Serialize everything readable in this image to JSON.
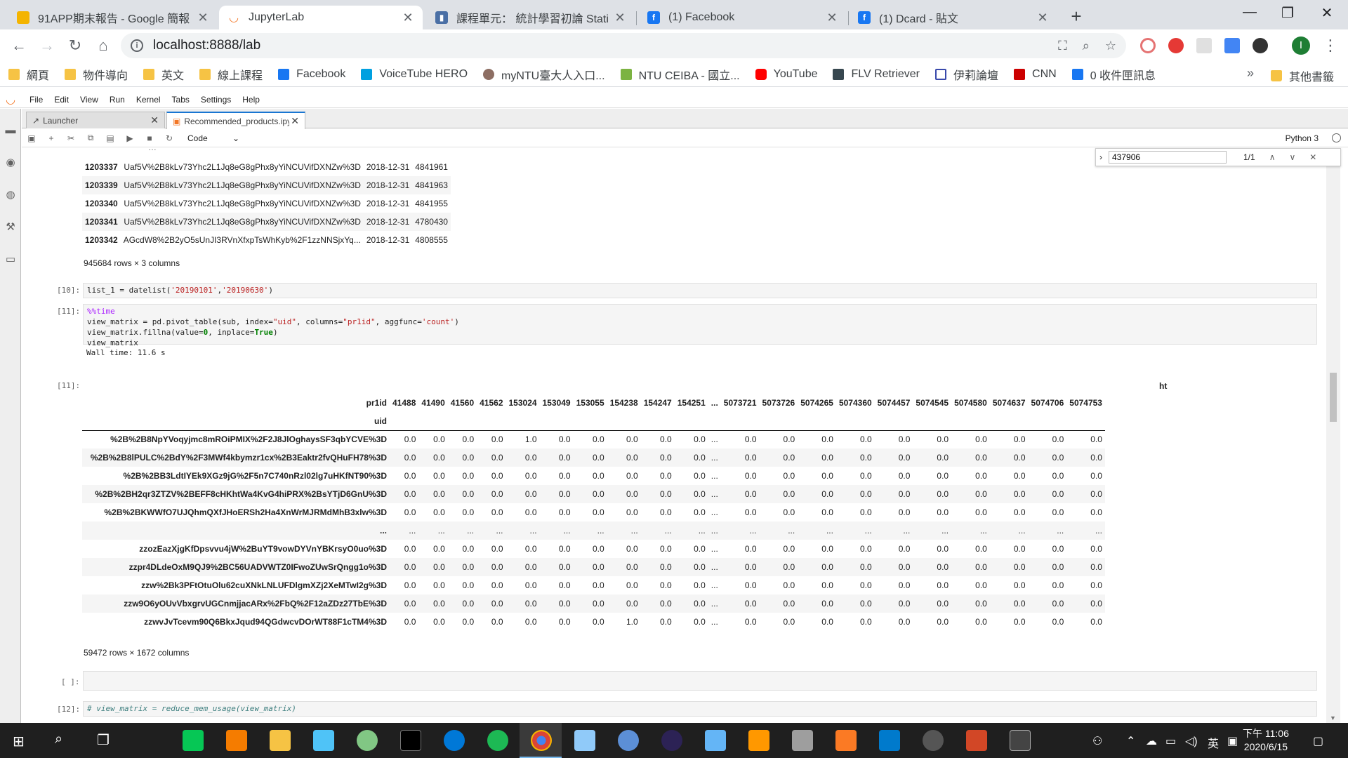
{
  "browser": {
    "tabs": [
      {
        "title": "91APP期末報告 - Google 簡報",
        "favicon": "slides"
      },
      {
        "title": "JupyterLab",
        "favicon": "jupyter",
        "active": true
      },
      {
        "title": "課程單元： 統計學習初論 Statisti",
        "favicon": "chart"
      },
      {
        "title": "(1) Facebook",
        "favicon": "facebook"
      },
      {
        "title": "(1) Dcard - 貼文",
        "favicon": "facebook"
      }
    ],
    "url": "localhost:8888/lab",
    "profile_initial": "I",
    "bookmarks": [
      {
        "label": "網頁",
        "icon": "folder"
      },
      {
        "label": "物件導向",
        "icon": "folder"
      },
      {
        "label": "英文",
        "icon": "folder"
      },
      {
        "label": "線上課程",
        "icon": "folder"
      },
      {
        "label": "Facebook",
        "icon": "facebook"
      },
      {
        "label": "VoiceTube HERO",
        "icon": "voicetube"
      },
      {
        "label": "myNTU臺大人入口...",
        "icon": "ntu"
      },
      {
        "label": "NTU CEIBA - 國立...",
        "icon": "ceiba"
      },
      {
        "label": "YouTube",
        "icon": "youtube"
      },
      {
        "label": "FLV Retriever",
        "icon": "flv"
      },
      {
        "label": "伊莉論壇",
        "icon": "eyny"
      },
      {
        "label": "CNN",
        "icon": "cnn"
      },
      {
        "label": "0 收件匣訊息",
        "icon": "facebook"
      }
    ],
    "bookmarks_more": "»",
    "other_bookmarks": "其他書籤"
  },
  "jupyter": {
    "menu": [
      "File",
      "Edit",
      "View",
      "Run",
      "Kernel",
      "Tabs",
      "Settings",
      "Help"
    ],
    "doc_tabs": [
      {
        "label": "Launcher",
        "active": false
      },
      {
        "label": "Recommended_products.ipy",
        "active": true
      }
    ],
    "cell_type": "Code",
    "kernel": "Python 3",
    "find": {
      "query": "437906",
      "count": "1/1"
    }
  },
  "output1": {
    "rows": [
      {
        "idx": "1203337",
        "uid": "Uaf5V%2B8kLv73Yhc2L1Jq8eG8gPhx8yYiNCUVifDXNZw%3D",
        "date": "2018-12-31",
        "id": "4841961"
      },
      {
        "idx": "1203339",
        "uid": "Uaf5V%2B8kLv73Yhc2L1Jq8eG8gPhx8yYiNCUVifDXNZw%3D",
        "date": "2018-12-31",
        "id": "4841963"
      },
      {
        "idx": "1203340",
        "uid": "Uaf5V%2B8kLv73Yhc2L1Jq8eG8gPhx8yYiNCUVifDXNZw%3D",
        "date": "2018-12-31",
        "id": "4841955"
      },
      {
        "idx": "1203341",
        "uid": "Uaf5V%2B8kLv73Yhc2L1Jq8eG8gPhx8yYiNCUVifDXNZw%3D",
        "date": "2018-12-31",
        "id": "4780430"
      },
      {
        "idx": "1203342",
        "uid": "AGcdW8%2B2yO5sUnJI3RVnXfxpTsWhKyb%2F1zzNNSjxYq...",
        "date": "2018-12-31",
        "id": "4808555"
      }
    ],
    "shape": "945684 rows × 3 columns"
  },
  "cell10": {
    "prompt": "[10]:"
  },
  "cell11": {
    "prompt": "[11]:",
    "wall_time": "Wall time: 11.6 s",
    "out_prompt": "[11]:"
  },
  "pivot": {
    "top_label": "ht",
    "columns_name": "pr1id",
    "index_name": "uid",
    "columns": [
      "41488",
      "41490",
      "41560",
      "41562",
      "153024",
      "153049",
      "153055",
      "154238",
      "154247",
      "154251",
      "...",
      "5073721",
      "5073726",
      "5074265",
      "5074360",
      "5074457",
      "5074545",
      "5074580",
      "5074637",
      "5074706",
      "5074753"
    ],
    "rows": [
      {
        "uid": "%2B%2B8NpYVoqyjmc8mROiPMIX%2F2J8JlOghaysSF3qbYCVE%3D",
        "values": [
          "0.0",
          "0.0",
          "0.0",
          "0.0",
          "1.0",
          "0.0",
          "0.0",
          "0.0",
          "0.0",
          "0.0",
          "...",
          "0.0",
          "0.0",
          "0.0",
          "0.0",
          "0.0",
          "0.0",
          "0.0",
          "0.0",
          "0.0",
          "0.0"
        ]
      },
      {
        "uid": "%2B%2B8lPULC%2BdY%2F3MWf4kbymzr1cx%2B3Eaktr2fvQHuFH78%3D",
        "values": [
          "0.0",
          "0.0",
          "0.0",
          "0.0",
          "0.0",
          "0.0",
          "0.0",
          "0.0",
          "0.0",
          "0.0",
          "...",
          "0.0",
          "0.0",
          "0.0",
          "0.0",
          "0.0",
          "0.0",
          "0.0",
          "0.0",
          "0.0",
          "0.0"
        ]
      },
      {
        "uid": "%2B%2BB3LdtIYEk9XGz9jG%2F5n7C740nRzl02lg7uHKfNT90%3D",
        "values": [
          "0.0",
          "0.0",
          "0.0",
          "0.0",
          "0.0",
          "0.0",
          "0.0",
          "0.0",
          "0.0",
          "0.0",
          "...",
          "0.0",
          "0.0",
          "0.0",
          "0.0",
          "0.0",
          "0.0",
          "0.0",
          "0.0",
          "0.0",
          "0.0"
        ]
      },
      {
        "uid": "%2B%2BH2qr3ZTZV%2BEFF8cHKhtWa4KvG4hiPRX%2BsYTjD6GnU%3D",
        "values": [
          "0.0",
          "0.0",
          "0.0",
          "0.0",
          "0.0",
          "0.0",
          "0.0",
          "0.0",
          "0.0",
          "0.0",
          "...",
          "0.0",
          "0.0",
          "0.0",
          "0.0",
          "0.0",
          "0.0",
          "0.0",
          "0.0",
          "0.0",
          "0.0"
        ]
      },
      {
        "uid": "%2B%2BKWWfO7UJQhmQXfJHoERSh2Ha4XnWrMJRMdMhB3xlw%3D",
        "values": [
          "0.0",
          "0.0",
          "0.0",
          "0.0",
          "0.0",
          "0.0",
          "0.0",
          "0.0",
          "0.0",
          "0.0",
          "...",
          "0.0",
          "0.0",
          "0.0",
          "0.0",
          "0.0",
          "0.0",
          "0.0",
          "0.0",
          "0.0",
          "0.0"
        ]
      },
      {
        "uid": "...",
        "values": [
          "...",
          "...",
          "...",
          "...",
          "...",
          "...",
          "...",
          "...",
          "...",
          "...",
          "...",
          "...",
          "...",
          "...",
          "...",
          "...",
          "...",
          "...",
          "...",
          "...",
          "..."
        ]
      },
      {
        "uid": "zzozEazXjgKfDpsvvu4jW%2BuYT9vowDYVnYBKrsyO0uo%3D",
        "values": [
          "0.0",
          "0.0",
          "0.0",
          "0.0",
          "0.0",
          "0.0",
          "0.0",
          "0.0",
          "0.0",
          "0.0",
          "...",
          "0.0",
          "0.0",
          "0.0",
          "0.0",
          "0.0",
          "0.0",
          "0.0",
          "0.0",
          "0.0",
          "0.0"
        ]
      },
      {
        "uid": "zzpr4DLdeOxM9QJ9%2BC56UADVWTZ0IFwoZUwSrQngg1o%3D",
        "values": [
          "0.0",
          "0.0",
          "0.0",
          "0.0",
          "0.0",
          "0.0",
          "0.0",
          "0.0",
          "0.0",
          "0.0",
          "...",
          "0.0",
          "0.0",
          "0.0",
          "0.0",
          "0.0",
          "0.0",
          "0.0",
          "0.0",
          "0.0",
          "0.0"
        ]
      },
      {
        "uid": "zzw%2Bk3PFtOtuOlu62cuXNkLNLUFDlgmXZj2XeMTwI2g%3D",
        "values": [
          "0.0",
          "0.0",
          "0.0",
          "0.0",
          "0.0",
          "0.0",
          "0.0",
          "0.0",
          "0.0",
          "0.0",
          "...",
          "0.0",
          "0.0",
          "0.0",
          "0.0",
          "0.0",
          "0.0",
          "0.0",
          "0.0",
          "0.0",
          "0.0"
        ]
      },
      {
        "uid": "zzw9O6yOUvVbxgrvUGCnmjjacARx%2FbQ%2F12aZDz27TbE%3D",
        "values": [
          "0.0",
          "0.0",
          "0.0",
          "0.0",
          "0.0",
          "0.0",
          "0.0",
          "0.0",
          "0.0",
          "0.0",
          "...",
          "0.0",
          "0.0",
          "0.0",
          "0.0",
          "0.0",
          "0.0",
          "0.0",
          "0.0",
          "0.0",
          "0.0"
        ]
      },
      {
        "uid": "zzwvJvTcevm90Q6BkxJqud94QGdwcvDOrWT88F1cTM4%3D",
        "values": [
          "0.0",
          "0.0",
          "0.0",
          "0.0",
          "0.0",
          "0.0",
          "0.0",
          "1.0",
          "0.0",
          "0.0",
          "...",
          "0.0",
          "0.0",
          "0.0",
          "0.0",
          "0.0",
          "0.0",
          "0.0",
          "0.0",
          "0.0",
          "0.0"
        ]
      }
    ],
    "shape": "59472 rows × 1672 columns"
  },
  "cell_empty": {
    "prompt": "[ ]:"
  },
  "cell12": {
    "prompt": "[12]:",
    "code": "# view_matrix = reduce_mem_usage(view_matrix)"
  },
  "taskbar": {
    "tray_lang": "英",
    "time": "下午 11:06",
    "date": "2020/6/15"
  }
}
